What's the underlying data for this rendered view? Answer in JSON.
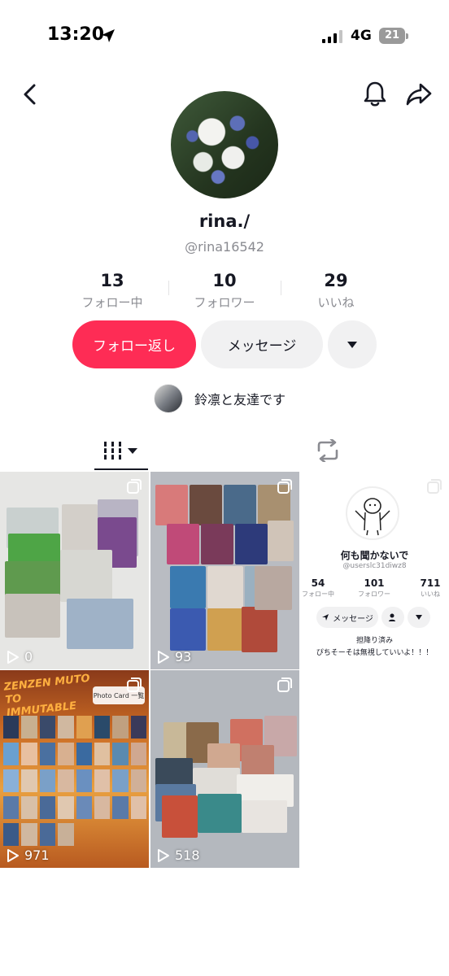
{
  "status_bar": {
    "time": "13:20",
    "network": "4G",
    "battery": "21"
  },
  "profile": {
    "username": "rina./",
    "handle": "@rina16542",
    "stats": [
      {
        "value": "13",
        "label": "フォロー中"
      },
      {
        "value": "10",
        "label": "フォロワー"
      },
      {
        "value": "29",
        "label": "いいね"
      }
    ],
    "follow_back_label": "フォロー返し",
    "message_label": "メッセージ",
    "mutual_text": "鈴凛と友達です"
  },
  "tabs": [
    {
      "name": "videos",
      "icon": "grid-icon",
      "active": true
    },
    {
      "name": "reposts",
      "icon": "repost-icon",
      "active": false
    }
  ],
  "videos": [
    {
      "views": "0",
      "multi": true
    },
    {
      "views": "93",
      "multi": true
    },
    {
      "views": "",
      "multi": true,
      "screenshot": {
        "name": "何も聞かないで",
        "handle": "@userslc31diwz8",
        "stats": [
          {
            "value": "54",
            "label": "フォロー中"
          },
          {
            "value": "101",
            "label": "フォロワー"
          },
          {
            "value": "711",
            "label": "いいね"
          }
        ],
        "message_label": "メッセージ",
        "bio_line1": "担降り済み",
        "bio_line2": "ぴちそーそは無視していいよ！！！"
      }
    },
    {
      "views": "971",
      "multi": true,
      "overlay_text": "Photo Card 一覧"
    },
    {
      "views": "518",
      "multi": true
    }
  ],
  "colors": {
    "accent": "#fe2c55",
    "text": "#161823",
    "muted": "#8a8b91",
    "button_bg": "#f1f1f2"
  }
}
